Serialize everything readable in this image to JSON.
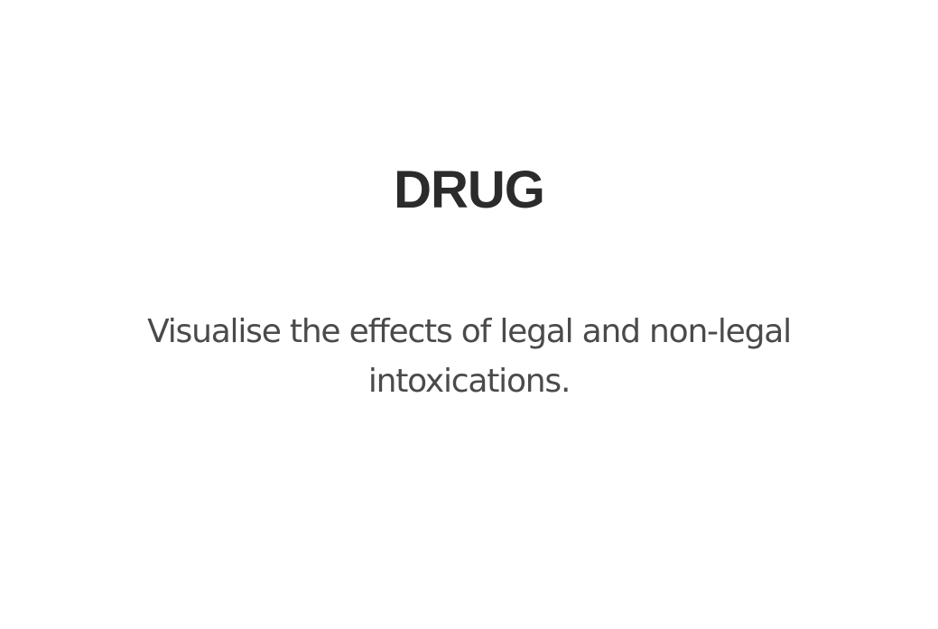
{
  "header": {
    "title": "DRUG"
  },
  "main": {
    "description": "Visualise the effects of legal and non-legal intoxications."
  },
  "colors": {
    "background": "#ffffff",
    "title": "#2b2b2b",
    "description": "#4a4a4a"
  }
}
